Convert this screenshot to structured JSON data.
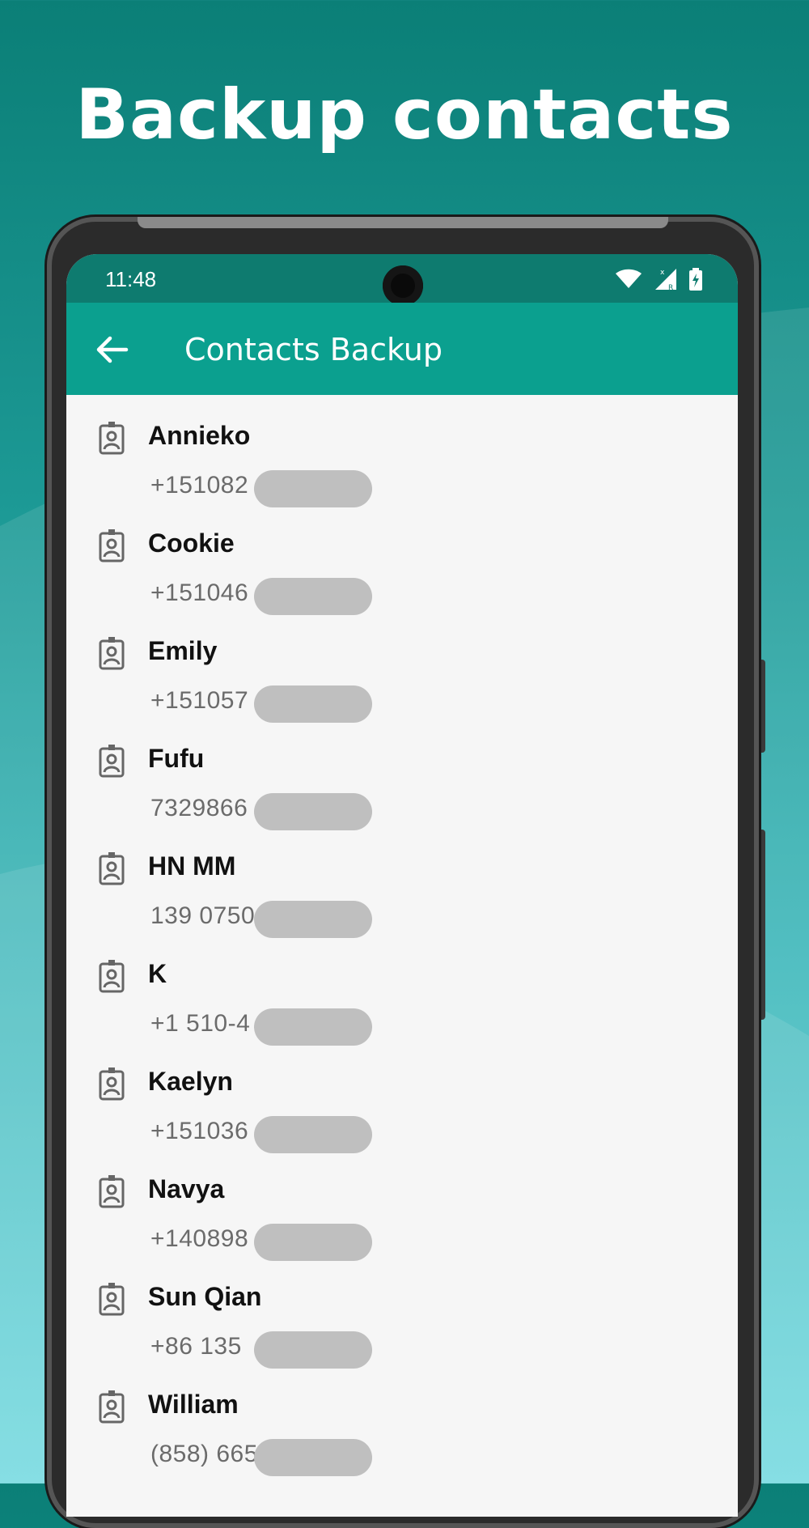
{
  "promo": {
    "title": "Backup contacts"
  },
  "status_bar": {
    "time": "11:48",
    "icons": [
      "wifi-icon",
      "signal-icon",
      "battery-icon"
    ]
  },
  "app_bar": {
    "title": "Contacts Backup",
    "back_icon": "back-arrow-icon"
  },
  "contacts": [
    {
      "name": "Annieko",
      "phone": "+151082"
    },
    {
      "name": "Cookie",
      "phone": "+151046"
    },
    {
      "name": "Emily",
      "phone": "+151057"
    },
    {
      "name": "Fufu",
      "phone": "7329866"
    },
    {
      "name": "HN MM",
      "phone": "139 0750"
    },
    {
      "name": "K",
      "phone": "+1 510-4"
    },
    {
      "name": "Kaelyn",
      "phone": "+151036"
    },
    {
      "name": "Navya",
      "phone": "+140898"
    },
    {
      "name": "Sun Qian",
      "phone": "+86 135"
    },
    {
      "name": "William",
      "phone": "(858) 665"
    }
  ],
  "colors": {
    "status_bar": "#0e7b6f",
    "app_bar": "#0ba08f",
    "list_background": "#f6f6f6",
    "redaction": "#bfbfbf"
  }
}
